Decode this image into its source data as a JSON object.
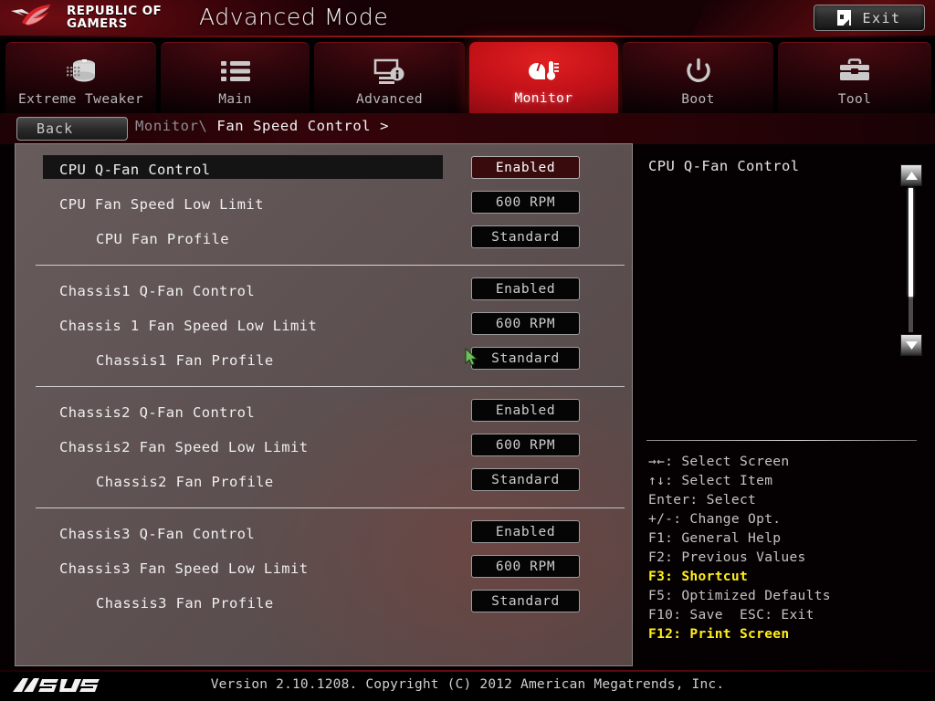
{
  "header": {
    "brand_line1": "REPUBLIC OF",
    "brand_line2": "GAMERS",
    "mode_title": "Advanced Mode",
    "exit_label": "Exit",
    "exit_icon": "exit-door-icon",
    "accent_color": "#c01018"
  },
  "tabs": [
    {
      "label": "Extreme Tweaker",
      "icon": "tweaker-icon",
      "active": false
    },
    {
      "label": "Main",
      "icon": "list-icon",
      "active": false
    },
    {
      "label": "Advanced",
      "icon": "monitor-info-icon",
      "active": false
    },
    {
      "label": "Monitor",
      "icon": "thermometer-gauge-icon",
      "active": true
    },
    {
      "label": "Boot",
      "icon": "power-icon",
      "active": false
    },
    {
      "label": "Tool",
      "icon": "toolbox-icon",
      "active": false
    }
  ],
  "nav": {
    "back_label": "Back",
    "back_icon": "back-arrow-icon",
    "breadcrumb_parent": "Monitor\\ ",
    "breadcrumb_current": "Fan Speed Control >"
  },
  "settings": {
    "groups": [
      {
        "rows": [
          {
            "label": "CPU Q-Fan Control",
            "value": "Enabled",
            "selected": true,
            "indent": 0
          },
          {
            "label": "CPU Fan Speed Low Limit",
            "value": "600 RPM",
            "selected": false,
            "indent": 0
          },
          {
            "label": "CPU Fan Profile",
            "value": "Standard",
            "selected": false,
            "indent": 1
          }
        ]
      },
      {
        "rows": [
          {
            "label": "Chassis1 Q-Fan Control",
            "value": "Enabled",
            "selected": false,
            "indent": 0
          },
          {
            "label": "Chassis 1 Fan Speed Low Limit",
            "value": "600 RPM",
            "selected": false,
            "indent": 0
          },
          {
            "label": "Chassis1 Fan Profile",
            "value": "Standard",
            "selected": false,
            "indent": 1
          }
        ]
      },
      {
        "rows": [
          {
            "label": "Chassis2 Q-Fan Control",
            "value": "Enabled",
            "selected": false,
            "indent": 0
          },
          {
            "label": "Chassis2 Fan Speed Low Limit",
            "value": "600 RPM",
            "selected": false,
            "indent": 0
          },
          {
            "label": "Chassis2 Fan Profile",
            "value": "Standard",
            "selected": false,
            "indent": 1
          }
        ]
      },
      {
        "rows": [
          {
            "label": "Chassis3 Q-Fan Control",
            "value": "Enabled",
            "selected": false,
            "indent": 0
          },
          {
            "label": "Chassis3 Fan Speed Low Limit",
            "value": "600 RPM",
            "selected": false,
            "indent": 0
          },
          {
            "label": "Chassis3 Fan Profile",
            "value": "Standard",
            "selected": false,
            "indent": 1
          }
        ]
      }
    ]
  },
  "scrollbar": {
    "up_icon": "triangle-up-icon",
    "down_icon": "triangle-down-icon",
    "thumb_percent": 75
  },
  "help": {
    "title": "CPU Q-Fan Control",
    "keys": [
      {
        "text": "→←: Select Screen",
        "highlight": false
      },
      {
        "text": "↑↓: Select Item",
        "highlight": false
      },
      {
        "text": "Enter: Select",
        "highlight": false
      },
      {
        "text": "+/-: Change Opt.",
        "highlight": false
      },
      {
        "text": "F1: General Help",
        "highlight": false
      },
      {
        "text": "F2: Previous Values",
        "highlight": false
      },
      {
        "text": "F3: Shortcut",
        "highlight": true
      },
      {
        "text": "F5: Optimized Defaults",
        "highlight": false
      },
      {
        "text": "F10: Save  ESC: Exit",
        "highlight": false
      },
      {
        "text": "F12: Print Screen",
        "highlight": true
      }
    ],
    "highlight_color": "#ffef1b"
  },
  "footer": {
    "brand": "ASUS",
    "version_text": "Version 2.10.1208. Copyright (C) 2012 American Megatrends, Inc."
  },
  "cursor": {
    "icon": "mouse-pointer-icon",
    "color": "#6fbf5e"
  }
}
